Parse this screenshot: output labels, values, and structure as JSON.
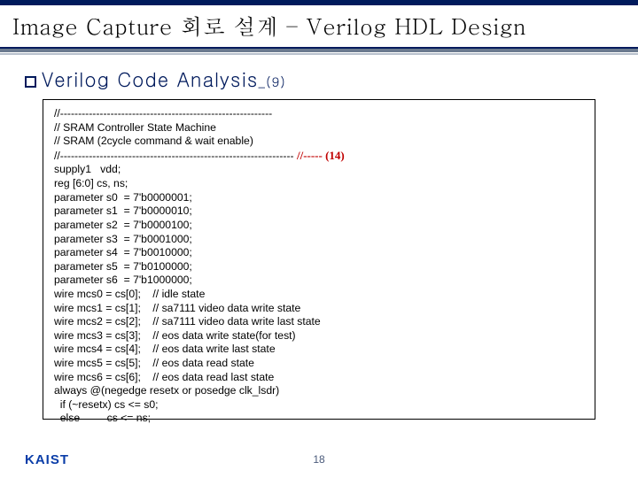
{
  "title": "Image Capture 회로 설계 – Verilog HDL Design",
  "subtitle_main": "Verilog Code Analysis",
  "subtitle_suffix": "_(9)",
  "annotation": "//----- (14)",
  "code": "//-----------------------------------------------------------\n// SRAM Controller State Machine\n// SRAM (2cycle command & wait enable)\n//----------------------------------------------------------------- ",
  "code2": "supply1   vdd;\nreg [6:0] cs, ns;\nparameter s0  = 7'b0000001;\nparameter s1  = 7'b0000010;\nparameter s2  = 7'b0000100;\nparameter s3  = 7'b0001000;\nparameter s4  = 7'b0010000;\nparameter s5  = 7'b0100000;\nparameter s6  = 7'b1000000;\nwire mcs0 = cs[0];    // idle state\nwire mcs1 = cs[1];    // sa7111 video data write state\nwire mcs2 = cs[2];    // sa7111 video data write last state\nwire mcs3 = cs[3];    // eos data write state(for test)\nwire mcs4 = cs[4];    // eos data write last state\nwire mcs5 = cs[5];    // eos data read state\nwire mcs6 = cs[6];    // eos data read last state\nalways @(negedge resetx or posedge clk_lsdr)\n  if (~resetx) cs <= s0;\n  else         cs <= ns;",
  "logo": "KAIST",
  "page_number": "18"
}
